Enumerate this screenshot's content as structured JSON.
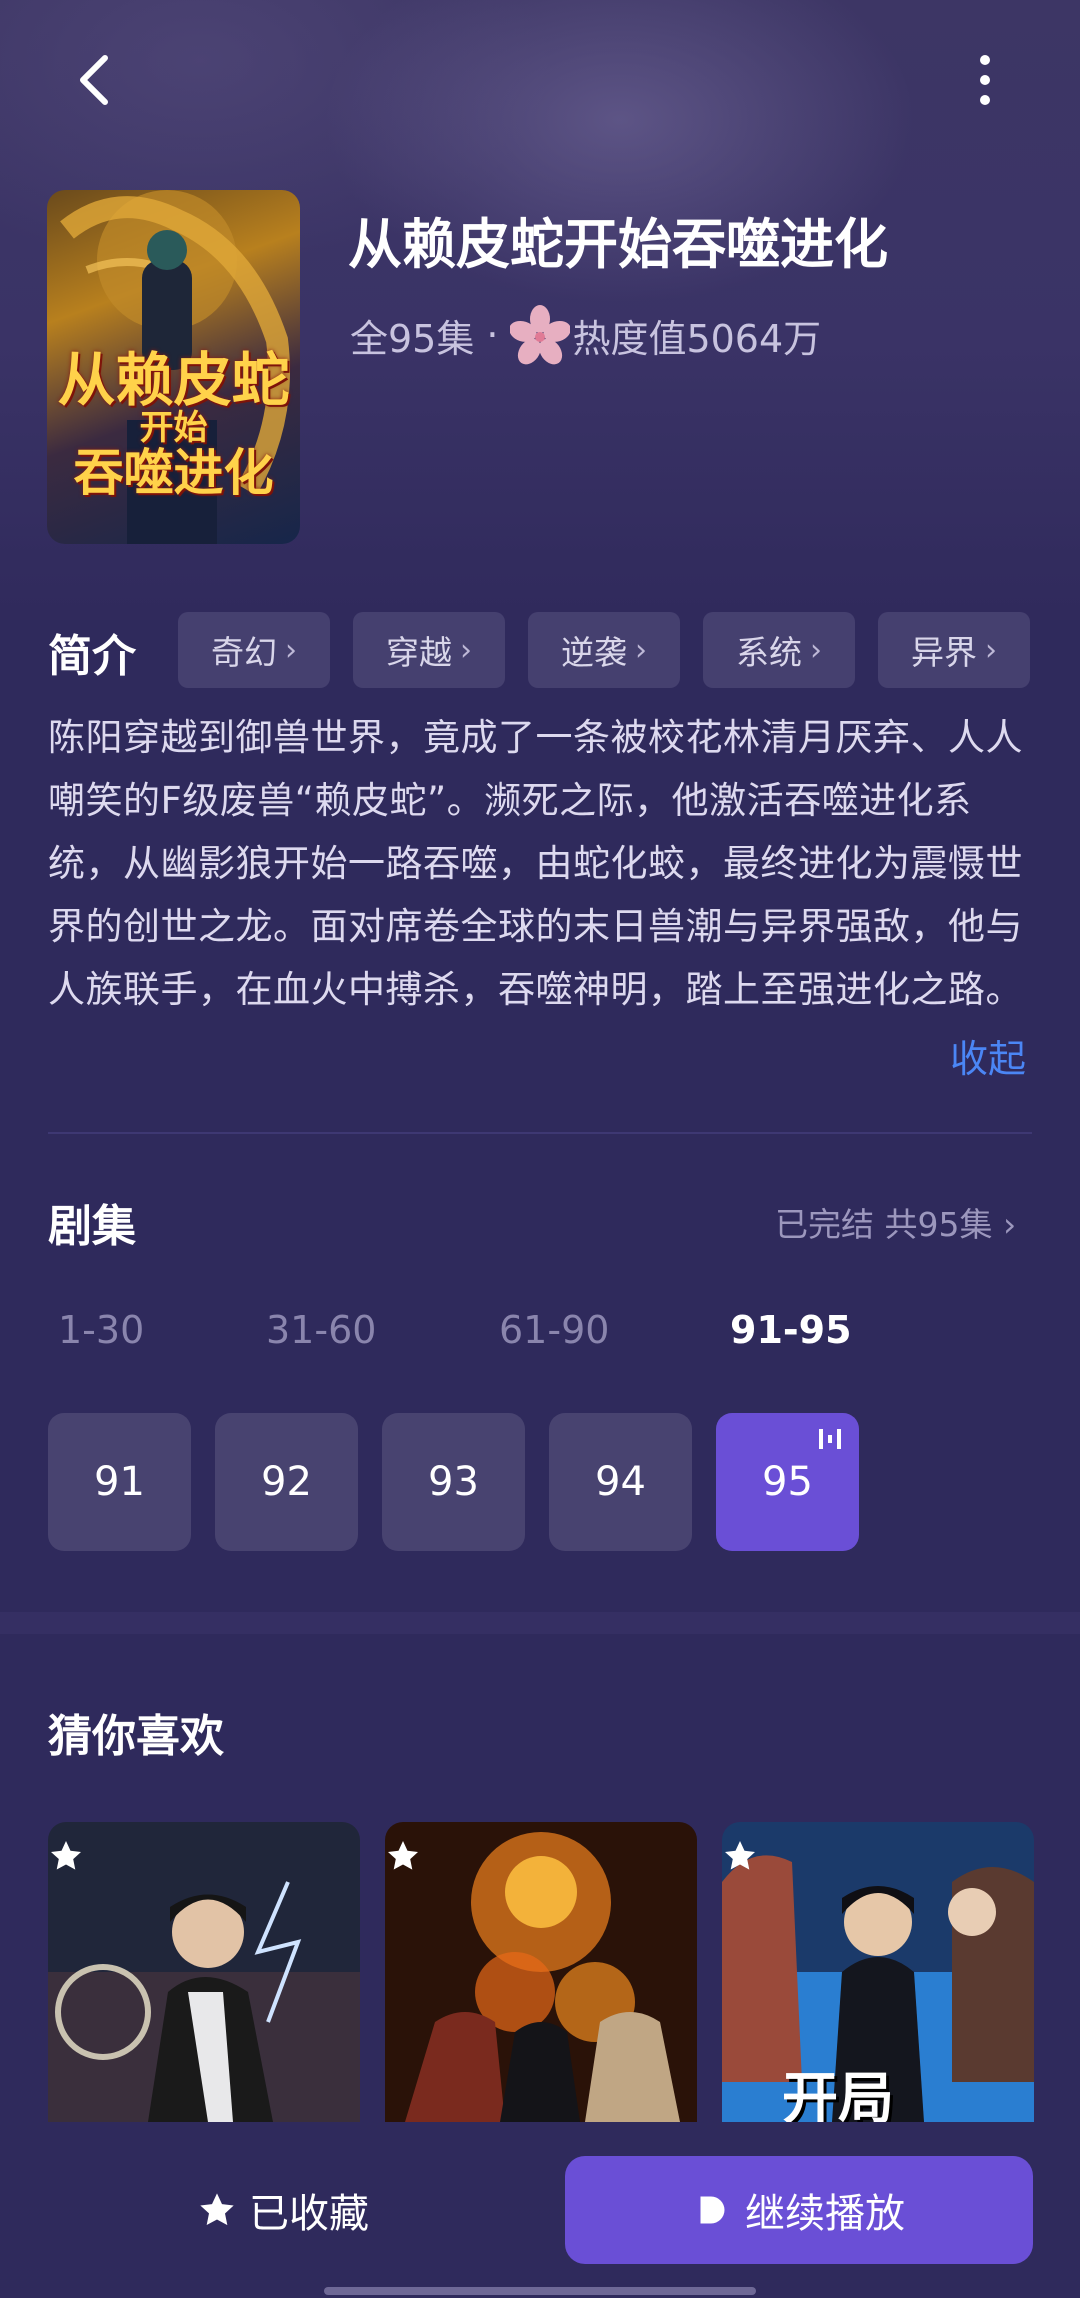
{
  "header": {
    "back_icon": "chevron-left-icon",
    "more_icon": "more-vertical-icon"
  },
  "drama": {
    "cover_text": {
      "line1": "从赖皮蛇",
      "line2": "开始",
      "line3": "吞噬进化"
    },
    "title": "从赖皮蛇开始吞噬进化",
    "episodes_total": "全95集",
    "separator": "·",
    "popularity": "热度值5064万"
  },
  "intro": {
    "label": "简介",
    "tags": [
      "奇幻",
      "穿越",
      "逆袭",
      "系统",
      "异界"
    ],
    "description": "陈阳穿越到御兽世界，竟成了一条被校花林清月厌弃、人人嘲笑的F级废兽“赖皮蛇”。濒死之际，他激活吞噬进化系统，从幽影狼开始一路吞噬，由蛇化蛟，最终进化为震慑世界的创世之龙。面对席卷全球的末日兽潮与异界强敌，他与人族联手，在血火中搏杀，吞噬神明，踏上至强进化之路。",
    "collapse_label": "收起"
  },
  "episodes": {
    "label": "剧集",
    "status": "已完结 共95集",
    "ranges": [
      "1-30",
      "31-60",
      "61-90",
      "91-95"
    ],
    "active_range": "91-95",
    "items": [
      "91",
      "92",
      "93",
      "94",
      "95"
    ],
    "current": "95"
  },
  "recommend": {
    "label": "猜你喜欢",
    "cards": [
      {
        "icon": "star-icon"
      },
      {
        "icon": "star-icon"
      },
      {
        "icon": "star-icon",
        "cover_text": "开局"
      }
    ]
  },
  "bottom": {
    "favorite_label": "已收藏",
    "play_label": "继续播放"
  },
  "colors": {
    "background": "#2f2a5c",
    "accent": "#6a4fd6",
    "link": "#4b86f5"
  }
}
